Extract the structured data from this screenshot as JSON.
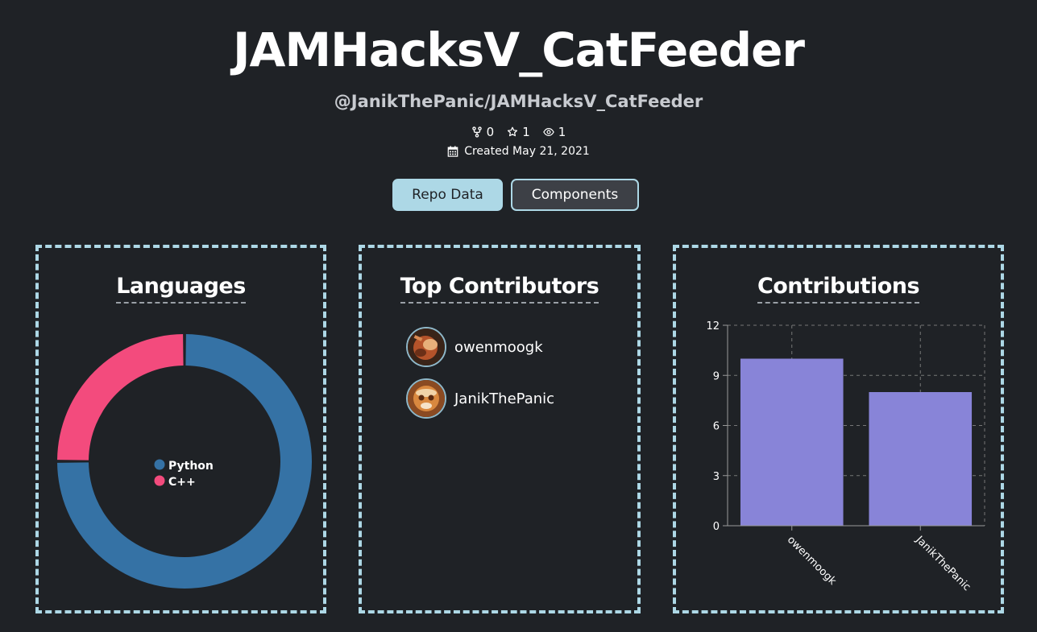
{
  "repo": {
    "title": "JAMHacksV_CatFeeder",
    "full_name": "@JanikThePanic/JAMHacksV_CatFeeder",
    "forks": "0",
    "stars": "1",
    "watchers": "1",
    "created": "Created May 21, 2021"
  },
  "tabs": {
    "repo_data": "Repo Data",
    "components": "Components"
  },
  "panels": {
    "languages": "Languages",
    "top_contributors": "Top Contributors",
    "contributions": "Contributions"
  },
  "contributors": [
    {
      "name": "owenmoogk"
    },
    {
      "name": "JanikThePanic"
    }
  ],
  "colors": {
    "background": "#1f2226",
    "accent": "#add8e6",
    "python": "#3572a5",
    "cpp": "#f34b7d",
    "bar": "#8884d8"
  },
  "chart_data": [
    {
      "type": "pie",
      "categories": [
        "Python",
        "C++"
      ],
      "values": [
        75,
        25
      ],
      "legend": "center"
    },
    {
      "type": "bar",
      "categories": [
        "owenmoogk",
        "JanikThePanic"
      ],
      "values": [
        10,
        8
      ],
      "yticks": [
        "0",
        "3",
        "6",
        "9",
        "12"
      ],
      "ylim": [
        0,
        12
      ],
      "grid": true
    }
  ]
}
